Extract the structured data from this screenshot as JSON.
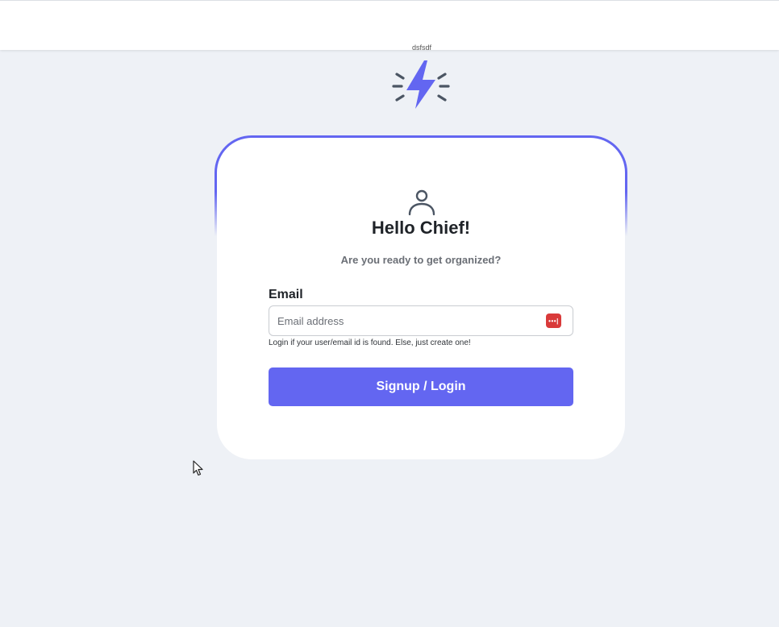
{
  "header": {
    "tiny_label": "dsfsdf"
  },
  "logo": {
    "icon": "lightning-bolt-icon",
    "color": "#6366f1"
  },
  "login_card": {
    "user_icon": "user-icon",
    "title": "Hello Chief!",
    "subtitle": "Are you ready to get organized?",
    "email_label": "Email",
    "email_placeholder": "Email address",
    "email_value": "",
    "password_manager_badge": "•••|",
    "helper_text": "Login if your user/email id is found. Else, just create one!",
    "submit_label": "Signup / Login"
  },
  "colors": {
    "accent": "#6366f1",
    "background": "#eef1f6",
    "card": "#ffffff",
    "badge": "#d93a3a"
  }
}
